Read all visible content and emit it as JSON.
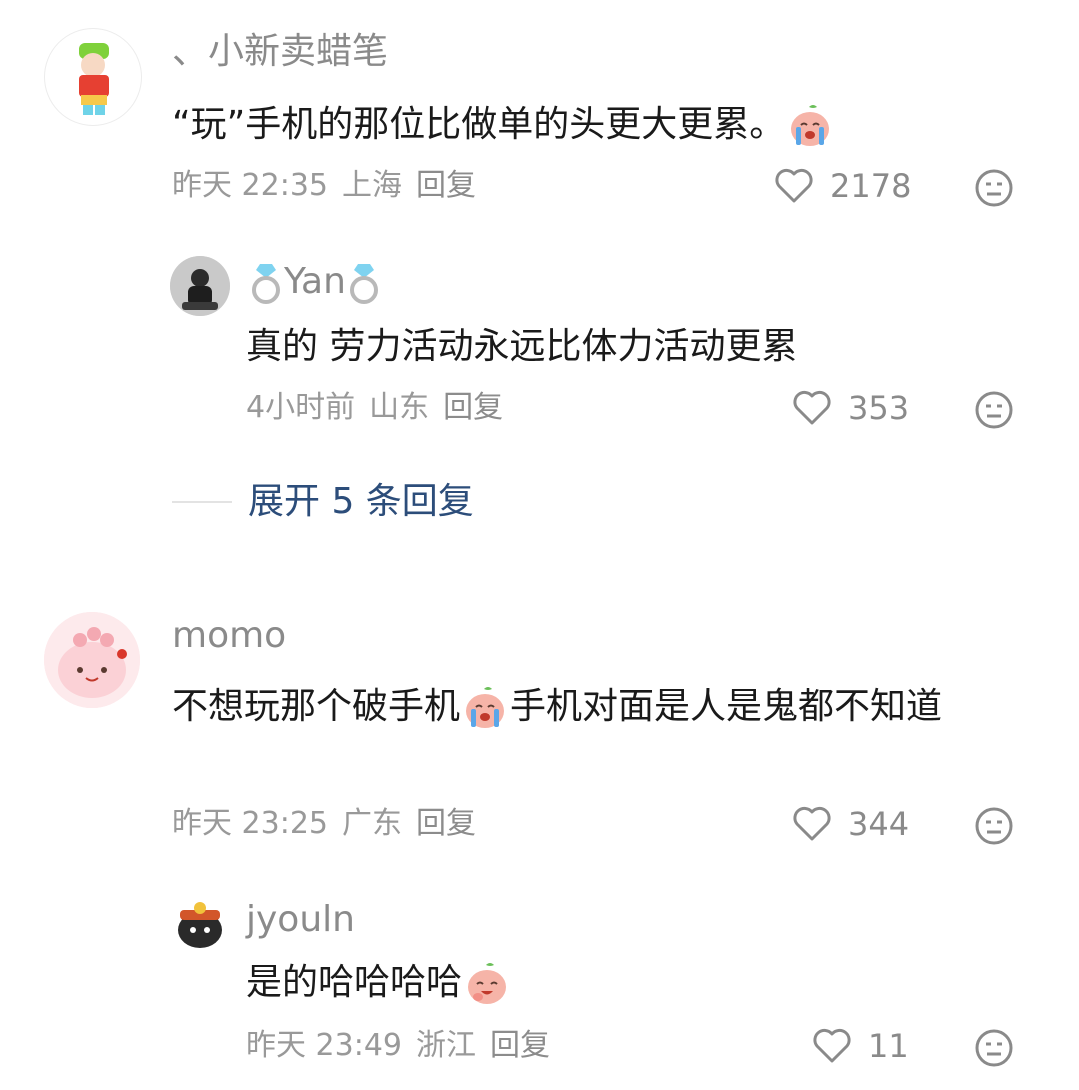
{
  "comments": [
    {
      "author": "、小新卖蜡笔",
      "text_before": "“玩”手机的那位比做单的头更大更累。",
      "emoji": "crying-peach-emoji",
      "time": "昨天 22:35",
      "location": "上海",
      "reply_label": "回复",
      "likes": "2178",
      "replies": [
        {
          "author": "Yan",
          "author_icon": "ring-emoji",
          "text": "真的 劳力活动永远比体力活动更累",
          "time": "4小时前",
          "location": "山东",
          "reply_label": "回复",
          "likes": "353"
        }
      ],
      "expand_label": "展开 5 条回复"
    },
    {
      "author": "momo",
      "text_before": "不想玩那个破手机",
      "emoji": "crying-peach-emoji",
      "text_after": "手机对面是人是鬼都不知道",
      "time": "昨天 23:25",
      "location": "广东",
      "reply_label": "回复",
      "likes": "344",
      "replies": [
        {
          "author": "jyouln",
          "text_before": "是的哈哈哈哈",
          "emoji": "laughing-peach-emoji",
          "time": "昨天 23:49",
          "location": "浙江",
          "reply_label": "回复",
          "likes": "11"
        }
      ]
    }
  ],
  "colors": {
    "link_blue": "#2c4d7a",
    "meta_gray": "#999999",
    "text": "#1a1a1a"
  }
}
